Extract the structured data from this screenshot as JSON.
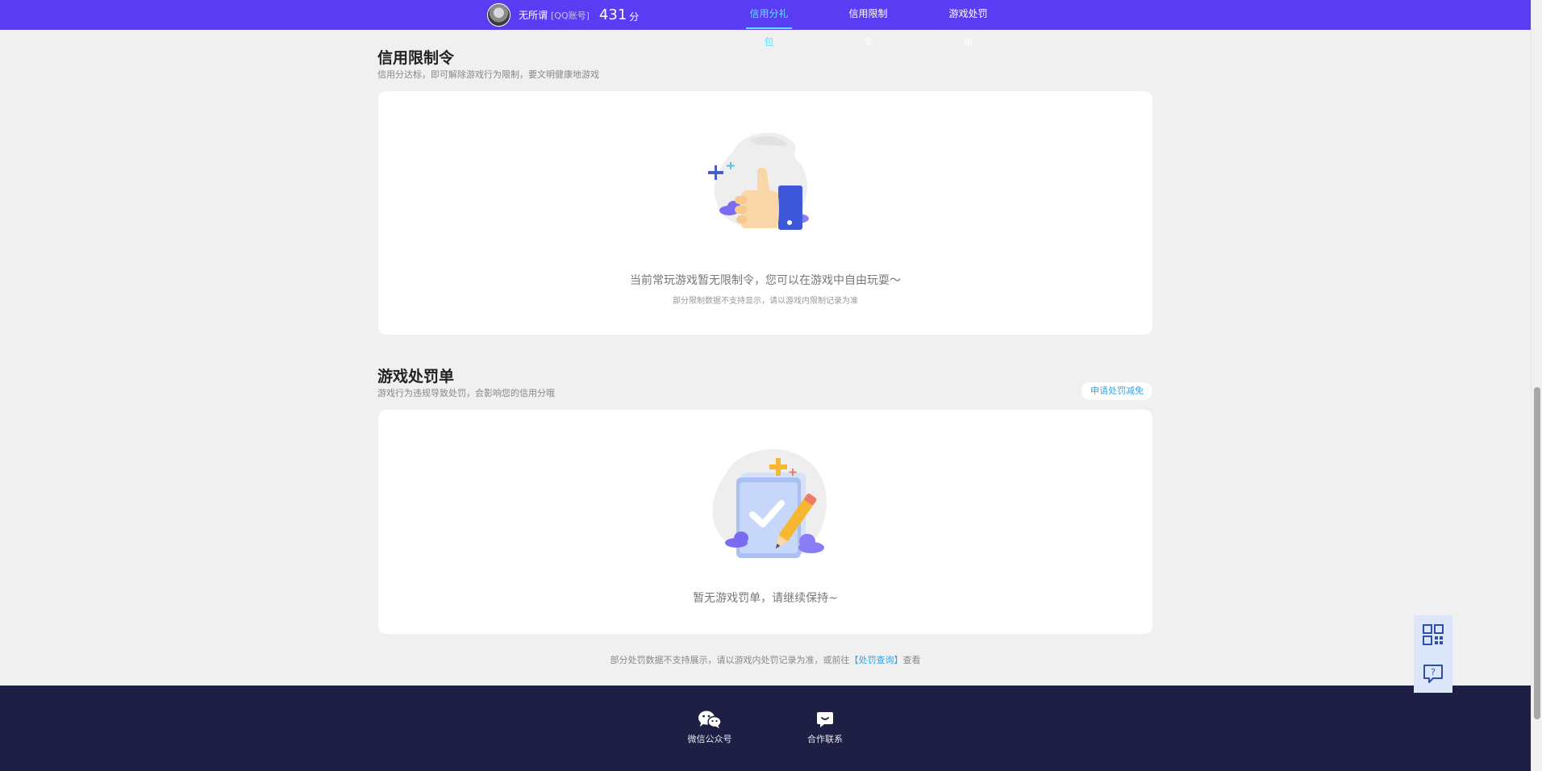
{
  "header": {
    "user_name": "无所谓",
    "account_type": "[QQ账号]",
    "score": "431",
    "score_unit": "分",
    "tabs": [
      {
        "label": "信用分礼包",
        "active": true
      },
      {
        "label": "信用限制令",
        "active": false
      },
      {
        "label": "游戏处罚单",
        "active": false
      }
    ],
    "accent_color": "#5a3df3"
  },
  "restriction": {
    "title": "信用限制令",
    "subtitle": "信用分达标，即可解除游戏行为限制，要文明健康地游戏",
    "empty_text": "当前常玩游戏暂无限制令，您可以在游戏中自由玩耍～",
    "empty_subtext": "部分限制数据不支持显示，请以游戏内限制记录为准"
  },
  "penalty": {
    "title": "游戏处罚单",
    "subtitle": "游戏行为违规导致处罚，会影响您的信用分哦",
    "appeal_button": "申请处罚减免",
    "empty_text": "暂无游戏罚单，请继续保持~"
  },
  "note": {
    "text_before": "部分处罚数据不支持展示，请以游戏内处罚记录为准，或前往",
    "link_text": "【处罚查询】",
    "text_after": "查看"
  },
  "footer": {
    "items": [
      {
        "label": "微信公众号",
        "icon": "wechat-icon"
      },
      {
        "label": "合作联系",
        "icon": "chat-bubble-icon"
      }
    ]
  },
  "floating": {
    "buttons": [
      {
        "icon": "qrcode-icon"
      },
      {
        "icon": "help-feedback-icon"
      }
    ]
  }
}
